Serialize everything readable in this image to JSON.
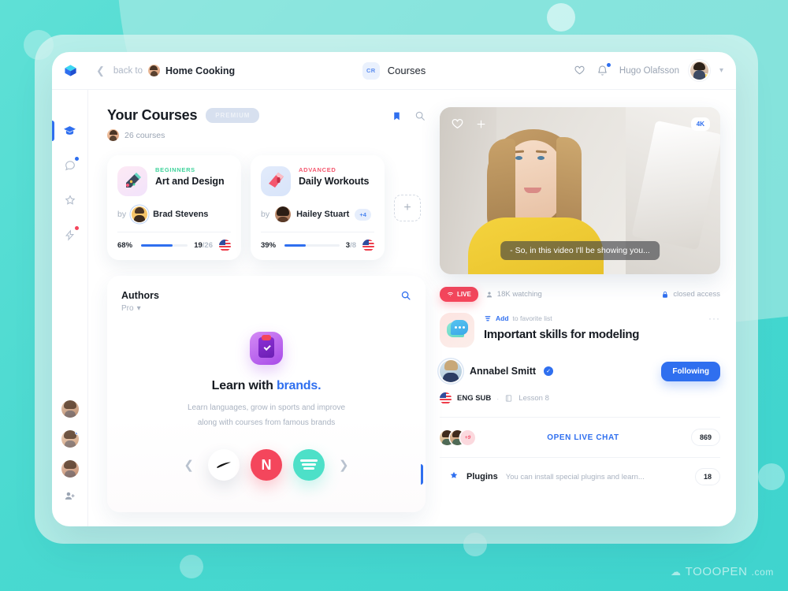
{
  "watermark": {
    "text": "TOOOPEN",
    "suffix": ".com",
    "icon": "cloud-icon"
  },
  "topbar": {
    "logo_icon": "cube-logo-icon",
    "back_chevron_icon": "chevron-left-icon",
    "back_label": "back to",
    "breadcrumb_avatar": "home-cooking-avatar",
    "breadcrumb_title": "Home Cooking",
    "center_badge": "CR",
    "page_title": "Courses",
    "heart_icon": "heart-icon",
    "bell_icon": "bell-icon",
    "user_name": "Hugo Olafsson",
    "user_avatar": "user-avatar",
    "user_chevron_icon": "chevron-down-icon"
  },
  "rail": {
    "items": [
      {
        "name": "graduation-cap-icon",
        "active": true,
        "dot": ""
      },
      {
        "name": "chat-bubble-icon",
        "active": false,
        "dot": "blue"
      },
      {
        "name": "star-outline-icon",
        "active": false,
        "dot": ""
      },
      {
        "name": "lightning-icon",
        "active": false,
        "dot": "red"
      }
    ],
    "avatars": [
      {
        "name": "rail-avatar-1",
        "dot": false
      },
      {
        "name": "rail-avatar-2",
        "dot": true
      },
      {
        "name": "rail-avatar-3",
        "dot": false
      }
    ],
    "add_person_icon": "add-person-icon"
  },
  "courses": {
    "title": "Your Courses",
    "premium_badge": "PREMIUM",
    "count_label": "26 courses",
    "bookmark_icon": "bookmark-icon",
    "search_icon": "search-icon",
    "add_card_icon": "plus-icon",
    "cards": [
      {
        "icon": "art-palette-icon",
        "level": "BEGINNERS",
        "name": "Art and Design",
        "by_label": "by",
        "author": "Brad Stevens",
        "extra_authors": "",
        "percent": "68%",
        "progress": 68,
        "done": "19",
        "total": "/26",
        "flag": "us-flag-icon"
      },
      {
        "icon": "boxing-glove-icon",
        "level": "ADVANCED",
        "name": "Daily Workouts",
        "by_label": "by",
        "author": "Hailey Stuart",
        "extra_authors": "+4",
        "percent": "39%",
        "progress": 39,
        "done": "3",
        "total": "/8",
        "flag": "us-flag-icon"
      }
    ]
  },
  "authors": {
    "title": "Authors",
    "filter_label": "Pro",
    "filter_chevron_icon": "chevron-down-icon",
    "search_icon": "search-icon",
    "app_icon": "clipboard-check-icon",
    "headline_plain": "Learn with ",
    "headline_accent": "brands.",
    "desc_line1": "Learn languages, grow in sports and improve",
    "desc_line2": "along with courses from famous brands",
    "prev_icon": "chevron-left-icon",
    "next_icon": "chevron-right-icon",
    "brands": [
      {
        "name": "nike-brand-icon",
        "label": ""
      },
      {
        "name": "netflix-brand-icon",
        "label": "N"
      },
      {
        "name": "spotify-brand-icon",
        "label": ""
      }
    ]
  },
  "video": {
    "heart_icon": "heart-icon",
    "plus_icon": "plus-icon",
    "quality_badge": "4K",
    "caption": "- So, in this video I'll be showing you..."
  },
  "stream": {
    "live_label": "LIVE",
    "live_icon": "wifi-icon",
    "watchers_icon": "person-icon",
    "watchers": "18K watching",
    "lock_icon": "lock-icon",
    "access": "closed access",
    "lesson_icon": "chat-bubbles-icon",
    "fav_icon": "list-icon",
    "fav_add": "Add",
    "fav_rest": "to favorite list",
    "more_icon": "more-dots-icon",
    "lesson_title": "Important skills for modeling",
    "author_avatar": "annabel-avatar",
    "author_name": "Annabel Smitt",
    "verified_icon": "verified-check-icon",
    "follow_button": "Following",
    "flag_icon": "us-flag-icon",
    "sub_label": "ENG SUB",
    "separator": "·",
    "lesson_book_icon": "book-icon",
    "lesson_number": "Lesson 8"
  },
  "chat": {
    "avatars": [
      "chat-avatar-1",
      "chat-avatar-2"
    ],
    "overflow_label": "+9",
    "open_label": "OPEN LIVE CHAT",
    "count": "869"
  },
  "plugins": {
    "star_icon": "star-filled-icon",
    "label": "Plugins",
    "description": "You can install special plugins and learn...",
    "count": "18"
  },
  "colors": {
    "accent_blue": "#2f6fef",
    "accent_red": "#f4465c",
    "accent_green": "#3fd39b",
    "bg_teal": "#49d9d0",
    "bg_mint": "#b9ece7"
  }
}
